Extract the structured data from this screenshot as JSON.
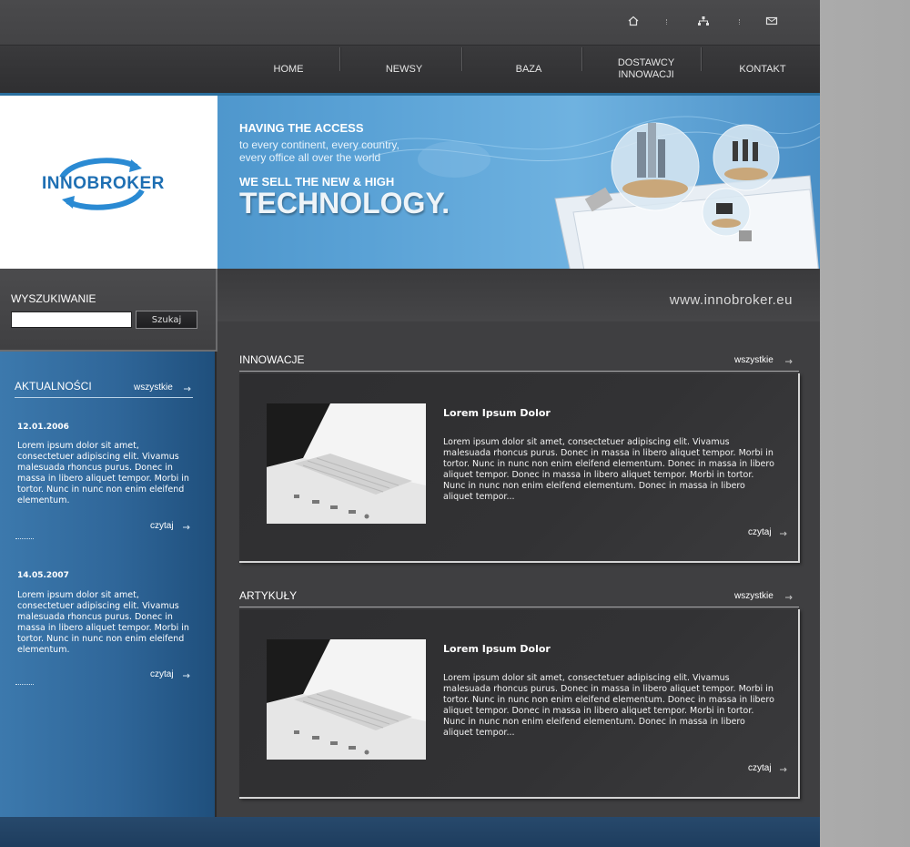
{
  "topbar": {
    "icons": [
      "home-icon",
      "sitemap-icon",
      "mail-icon"
    ]
  },
  "nav": {
    "items": [
      {
        "label": "HOME"
      },
      {
        "label": "NEWSY"
      },
      {
        "label": "BAZA"
      },
      {
        "label": "DOSTAWCY\nINNOWACJI"
      },
      {
        "label": "KONTAKT"
      }
    ]
  },
  "banner": {
    "logo": "INNOBROKER",
    "line1": "HAVING THE ACCESS",
    "line2": "to every continent, every country,",
    "line3": "every office all over the world",
    "line4": "WE SELL THE NEW & HIGH",
    "line5": "TECHNOLOGY.",
    "url": "www.innobroker.eu"
  },
  "search": {
    "title": "WYSZUKIWANIE",
    "input_value": "",
    "button": "Szukaj"
  },
  "news": {
    "title": "AKTUALNOŚCI",
    "all_label": "wszystkie",
    "items": [
      {
        "date": "12.01.2006",
        "text": "Lorem ipsum dolor sit amet, consectetuer adipiscing elit. Vivamus malesuada rhoncus purus. Donec in massa in libero aliquet tempor. Morbi in tortor. Nunc in nunc non enim eleifend elementum.",
        "more": "czytaj"
      },
      {
        "date": "14.05.2007",
        "text": "Lorem ipsum dolor sit amet, consectetuer adipiscing elit. Vivamus malesuada rhoncus purus. Donec in massa in libero aliquet tempor. Morbi in tortor. Nunc in nunc non enim eleifend elementum.",
        "more": "czytaj"
      }
    ]
  },
  "sections": [
    {
      "title": "INNOWACJE",
      "all_label": "wszystkie",
      "card": {
        "title": "Lorem Ipsum Dolor",
        "text": "Lorem ipsum dolor sit amet, consectetuer adipiscing elit. Vivamus malesuada rhoncus purus. Donec in massa in libero aliquet tempor. Morbi in tortor. Nunc in nunc non enim eleifend elementum. Donec in massa in libero aliquet tempor. Donec in massa in libero aliquet tempor. Morbi in tortor. Nunc in nunc non enim eleifend elementum. Donec in massa in libero aliquet tempor...",
        "more": "czytaj"
      }
    },
    {
      "title": "ARTYKUŁY",
      "all_label": "wszystkie",
      "card": {
        "title": "Lorem Ipsum Dolor",
        "text": "Lorem ipsum dolor sit amet, consectetuer adipiscing elit. Vivamus malesuada rhoncus purus. Donec in massa in libero aliquet tempor. Morbi in tortor. Nunc in nunc non enim eleifend elementum. Donec in massa in libero aliquet tempor. Donec in massa in libero aliquet tempor. Morbi in tortor. Nunc in nunc non enim eleifend elementum. Donec in massa in libero aliquet tempor...",
        "more": "czytaj"
      }
    }
  ],
  "colors": {
    "brand_blue": "#1e6fb3",
    "nav_accent": "#2a6f9e",
    "page_bg": "#3f3f41"
  }
}
